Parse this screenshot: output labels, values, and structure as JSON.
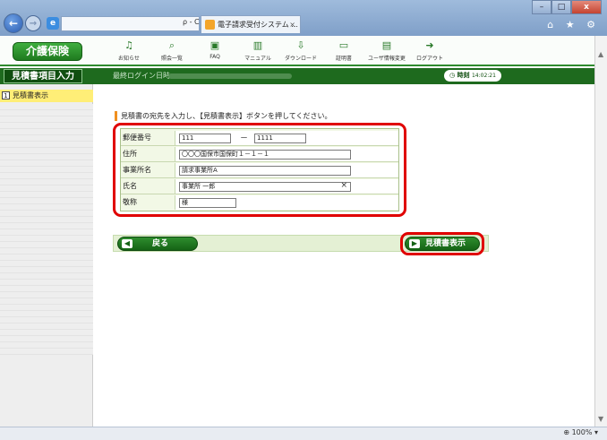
{
  "browser": {
    "address_controls": "ρ - C",
    "tab_title": "電子請求受付システム ...",
    "tab_close": "×",
    "right_icons": "⌂ ★ ⚙",
    "zoom": "100%",
    "win_min": "–",
    "win_max": "□",
    "win_close": "x"
  },
  "header": {
    "logo": "介護保険",
    "tools": [
      {
        "label": "お知らせ",
        "icon": "bell-icon"
      },
      {
        "label": "照会一覧",
        "icon": "search-icon"
      },
      {
        "label": "FAQ",
        "icon": "faq-icon"
      },
      {
        "label": "マニュアル",
        "icon": "book-icon"
      },
      {
        "label": "ダウンロード",
        "icon": "download-icon"
      },
      {
        "label": "証明書",
        "icon": "certificate-icon"
      },
      {
        "label": "ユーザ情報変更",
        "icon": "user-edit-icon"
      },
      {
        "label": "ログアウト",
        "icon": "logout-icon"
      }
    ]
  },
  "title_strip": {
    "screen_title": "見積書項目入力",
    "login_label": "最終ログイン日時",
    "clock_label": "時刻",
    "clock_time": "14:02:21"
  },
  "sidebar": {
    "item_num": "1",
    "item_label": "見積書表示"
  },
  "main": {
    "instruction": "見積書の宛先を入力し、【見積書表示】ボタンを押してください。",
    "fields": {
      "postal": {
        "label": "郵便番号",
        "value1": "111",
        "dash": "－",
        "value2": "1111"
      },
      "address": {
        "label": "住所",
        "value": "〇〇〇国保市国保町１－１－１"
      },
      "office": {
        "label": "事業所名",
        "value": "請求事業所A"
      },
      "name": {
        "label": "氏名",
        "value": "事業所 一郎",
        "clear": "×"
      },
      "honorific": {
        "label": "敬称",
        "value": "様"
      }
    },
    "back_button": "戻る",
    "estimate_button": "見積書表示"
  },
  "colors": {
    "brand_green": "#1e6a1e",
    "highlight_red": "#e00000",
    "sidebar_active": "#ffee77"
  }
}
